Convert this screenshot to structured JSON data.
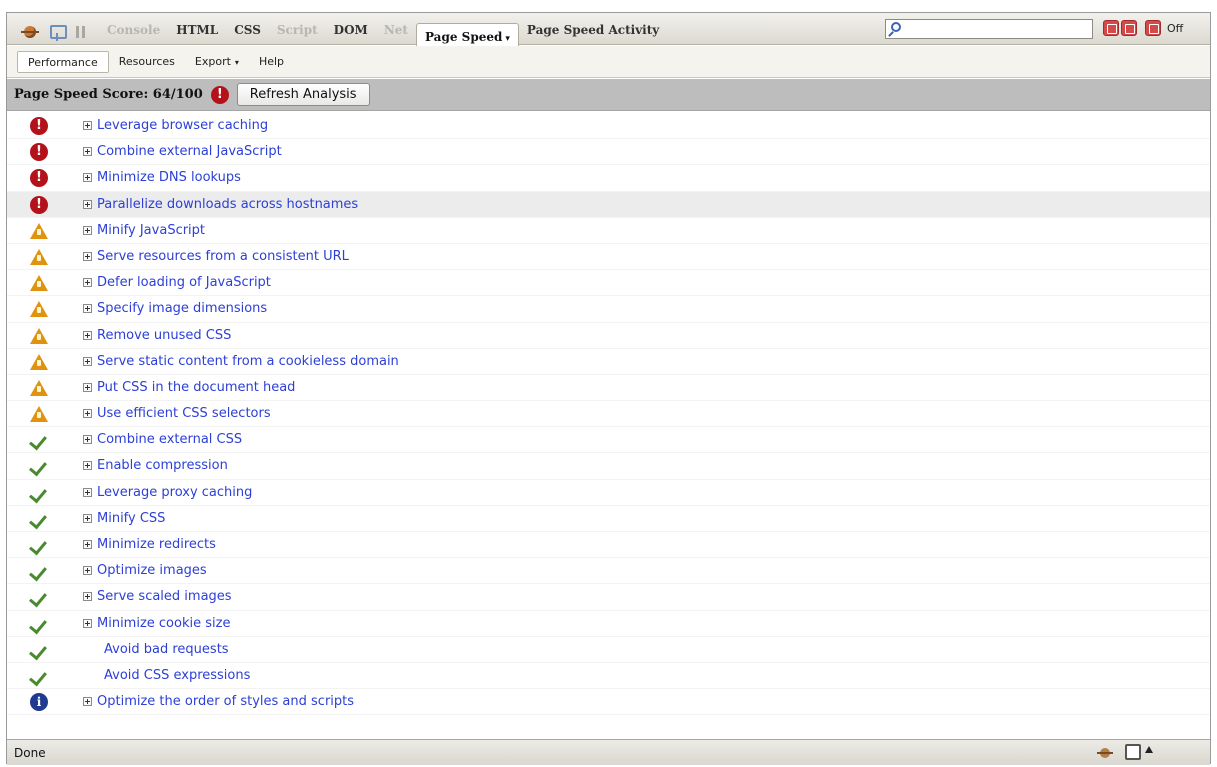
{
  "firebug": {
    "tabs": [
      {
        "label": "Console",
        "state": "disabled"
      },
      {
        "label": "HTML",
        "state": "normal"
      },
      {
        "label": "CSS",
        "state": "normal"
      },
      {
        "label": "Script",
        "state": "disabled"
      },
      {
        "label": "DOM",
        "state": "normal"
      },
      {
        "label": "Net",
        "state": "disabled"
      },
      {
        "label": "Page Speed",
        "state": "active"
      },
      {
        "label": "Page Speed Activity",
        "state": "normal"
      }
    ],
    "active_tab_caret": "▾",
    "search_value": "",
    "off_label": "Off"
  },
  "subtoolbar": {
    "tabs": [
      "Performance",
      "Resources",
      "Export",
      "Help"
    ],
    "active": "Performance",
    "export_caret": "▾"
  },
  "score": {
    "text": "Page Speed Score: 64/100",
    "status": "error",
    "refresh_label": "Refresh Analysis"
  },
  "rules": [
    {
      "label": "Leverage browser caching",
      "status": "error",
      "expandable": true
    },
    {
      "label": "Combine external JavaScript",
      "status": "error",
      "expandable": true
    },
    {
      "label": "Minimize DNS lookups",
      "status": "error",
      "expandable": true
    },
    {
      "label": "Parallelize downloads across hostnames",
      "status": "error",
      "expandable": true,
      "highlighted": true
    },
    {
      "label": "Minify JavaScript",
      "status": "warning",
      "expandable": true
    },
    {
      "label": "Serve resources from a consistent URL",
      "status": "warning",
      "expandable": true
    },
    {
      "label": "Defer loading of JavaScript",
      "status": "warning",
      "expandable": true
    },
    {
      "label": "Specify image dimensions",
      "status": "warning",
      "expandable": true
    },
    {
      "label": "Remove unused CSS",
      "status": "warning",
      "expandable": true
    },
    {
      "label": "Serve static content from a cookieless domain",
      "status": "warning",
      "expandable": true
    },
    {
      "label": "Put CSS in the document head",
      "status": "warning",
      "expandable": true
    },
    {
      "label": "Use efficient CSS selectors",
      "status": "warning",
      "expandable": true
    },
    {
      "label": "Combine external CSS",
      "status": "pass",
      "expandable": true
    },
    {
      "label": "Enable compression",
      "status": "pass",
      "expandable": true
    },
    {
      "label": "Leverage proxy caching",
      "status": "pass",
      "expandable": true
    },
    {
      "label": "Minify CSS",
      "status": "pass",
      "expandable": true
    },
    {
      "label": "Minimize redirects",
      "status": "pass",
      "expandable": true
    },
    {
      "label": "Optimize images",
      "status": "pass",
      "expandable": true
    },
    {
      "label": "Serve scaled images",
      "status": "pass",
      "expandable": true
    },
    {
      "label": "Minimize cookie size",
      "status": "pass",
      "expandable": true
    },
    {
      "label": "Avoid bad requests",
      "status": "pass",
      "expandable": false
    },
    {
      "label": "Avoid CSS expressions",
      "status": "pass",
      "expandable": false
    },
    {
      "label": "Optimize the order of styles and scripts",
      "status": "info",
      "expandable": true
    }
  ],
  "statusbar": {
    "text": "Done"
  },
  "colors": {
    "link": "#2c3fd6",
    "error": "#b3121a",
    "warning": "#e0930f",
    "pass": "#4a8a2f",
    "info": "#203a8f",
    "score_bar": "#bdbdbd"
  }
}
